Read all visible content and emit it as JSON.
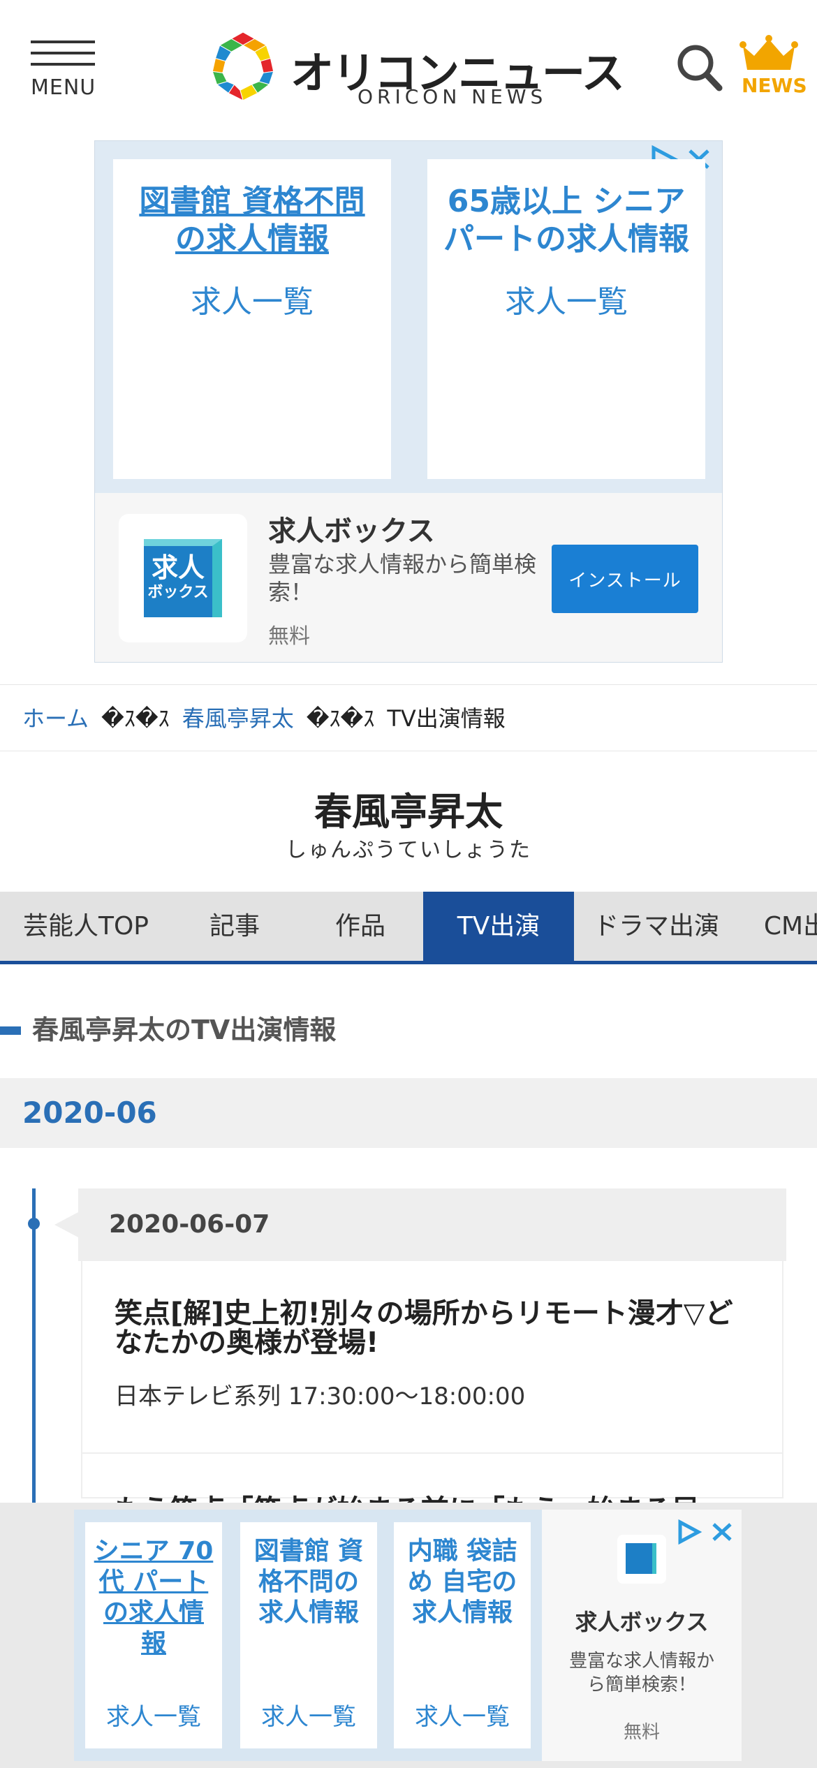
{
  "header": {
    "menu_label": "MENU",
    "logo_title": "オリコンニュース",
    "logo_subtitle": "ORICON NEWS",
    "news_label": "NEWS"
  },
  "top_ad": {
    "tiles": [
      {
        "title": "図書館 資格不問の求人情報",
        "sub": "求人一覧"
      },
      {
        "title": "65歳以上 シニアパートの求人情報",
        "sub": "求人一覧"
      }
    ],
    "app": {
      "name": "求人ボックス",
      "desc": "豊富な求人情報から簡単検索！",
      "price": "無料",
      "install": "インストール",
      "icon_text_top": "求人",
      "icon_text_bottom": "ボックス"
    }
  },
  "breadcrumb": {
    "home": "ホーム",
    "sep": "�ｽ�ｽ",
    "person": "春風亭昇太",
    "current": "TV出演情報"
  },
  "profile": {
    "name": "春風亭昇太",
    "kana": "しゅんぷうていしょうた"
  },
  "tabs": [
    {
      "label": "芸能人TOP"
    },
    {
      "label": "記事"
    },
    {
      "label": "作品"
    },
    {
      "label": "TV出演"
    },
    {
      "label": "ドラマ出演"
    },
    {
      "label": "CM出演"
    }
  ],
  "section": {
    "title": "春風亭昇太のTV出演情報",
    "month": "2020-06"
  },
  "entry": {
    "date": "2020-06-07",
    "program1_title": "笑点[解]史上初!別々の場所からリモート漫才▽どなたかの奥様が登場!",
    "program1_meta": "日本テレビ系列 17:30:00〜18:00:00",
    "program2_title": "もう笑点「笑点が始まる前に「もう」始まる局"
  },
  "bottom_ad": {
    "tiles": [
      {
        "title": "シニア 70代 パートの求人情報",
        "sub": "求人一覧"
      },
      {
        "title": "図書館 資格不問の求人情報",
        "sub": "求人一覧"
      },
      {
        "title": "内職 袋詰め 自宅の求人情報",
        "sub": "求人一覧"
      }
    ],
    "app": {
      "name": "求人ボックス",
      "desc": "豊富な求人情報から簡単検索！",
      "price": "無料"
    }
  },
  "colors": {
    "accent": "#1a4e99",
    "link": "#2a6fb6",
    "ad_text": "#2d86d0",
    "crown": "#f2a500"
  }
}
